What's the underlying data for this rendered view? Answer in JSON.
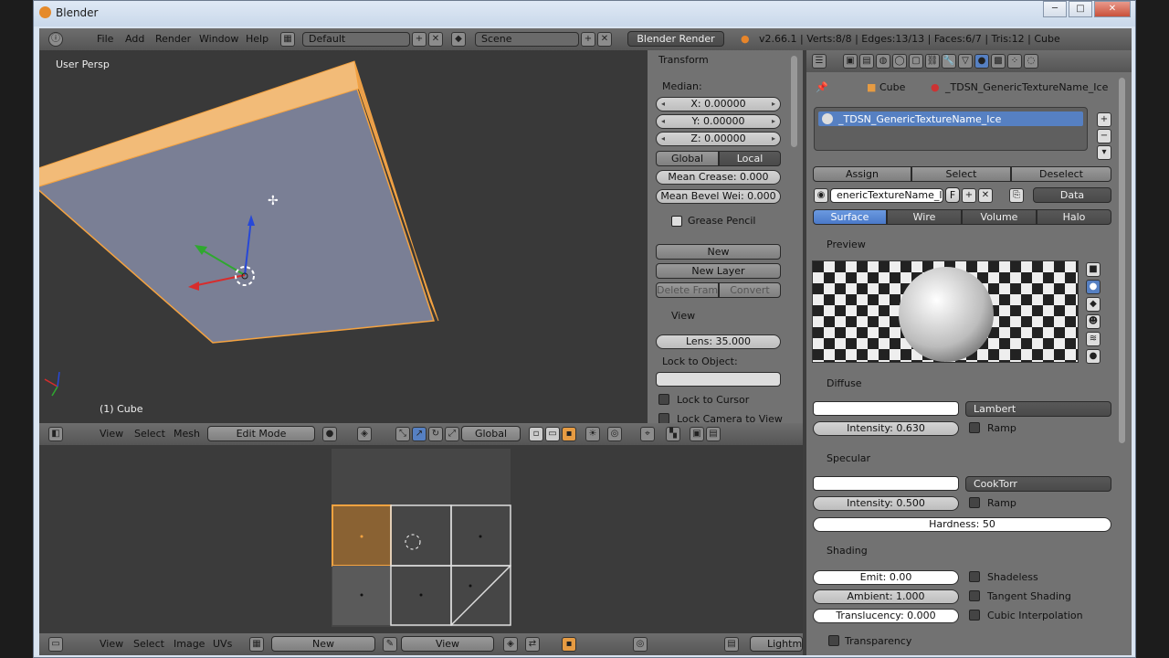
{
  "window": {
    "title": "Blender",
    "minimize": "─",
    "maximize": "□",
    "close": "✕"
  },
  "info_header": {
    "menus": [
      "File",
      "Add",
      "Render",
      "Window",
      "Help"
    ],
    "screen_layout": "Default",
    "scene": "Scene",
    "render_engine": "Blender Render",
    "stats": "v2.66.1 | Verts:8/8 | Edges:13/13 | Faces:6/7 | Tris:12 | Cube"
  },
  "viewport": {
    "view_name": "User Persp",
    "object_label": "(1) Cube",
    "header": {
      "menus": [
        "View",
        "Select",
        "Mesh"
      ],
      "mode": "Edit Mode",
      "orientation": "Global"
    }
  },
  "n_panel": {
    "transform": {
      "title": "Transform",
      "median_label": "Median:",
      "x": "X: 0.00000",
      "y": "Y: 0.00000",
      "z": "Z: 0.00000",
      "global": "Global",
      "local": "Local",
      "mean_crease": "Mean Crease: 0.000",
      "mean_bevel": "Mean Bevel Wei: 0.000"
    },
    "grease_pencil": {
      "title": "Grease Pencil",
      "new": "New",
      "new_layer": "New Layer",
      "delete_frame": "Delete Frame",
      "convert": "Convert"
    },
    "view": {
      "title": "View",
      "lens": "Lens: 35.000",
      "lock_to_object": "Lock to Object:",
      "lock_to_cursor": "Lock to Cursor",
      "lock_camera": "Lock Camera to View"
    }
  },
  "uv_editor": {
    "header": {
      "menus": [
        "View",
        "Select",
        "Image",
        "UVs"
      ],
      "new": "New",
      "view": "View",
      "lightmap": "Lightma"
    }
  },
  "properties": {
    "breadcrumb": {
      "object": "Cube",
      "material": "_TDSN_GenericTextureName_Ice"
    },
    "slot_name": "_TDSN_GenericTextureName_Ice",
    "assign": "Assign",
    "select": "Select",
    "deselect": "Deselect",
    "material_field": "enericTextureName_Ice",
    "f_label": "F",
    "link": "Data",
    "tabs": [
      "Surface",
      "Wire",
      "Volume",
      "Halo"
    ],
    "preview_title": "Preview",
    "diffuse": {
      "title": "Diffuse",
      "shader": "Lambert",
      "intensity": "Intensity: 0.630",
      "ramp": "Ramp"
    },
    "specular": {
      "title": "Specular",
      "shader": "CookTorr",
      "intensity": "Intensity: 0.500",
      "ramp": "Ramp",
      "hardness": "Hardness: 50"
    },
    "shading": {
      "title": "Shading",
      "emit": "Emit: 0.00",
      "ambient": "Ambient: 1.000",
      "translucency": "Translucency: 0.000",
      "shadeless": "Shadeless",
      "tangent": "Tangent Shading",
      "cubic": "Cubic Interpolation"
    },
    "transparency": {
      "title": "Transparency"
    }
  },
  "colors": {
    "viewport_bg": "#393939",
    "selection": "#f5a340",
    "accent_blue": "#5680c2",
    "header": "#606060"
  }
}
